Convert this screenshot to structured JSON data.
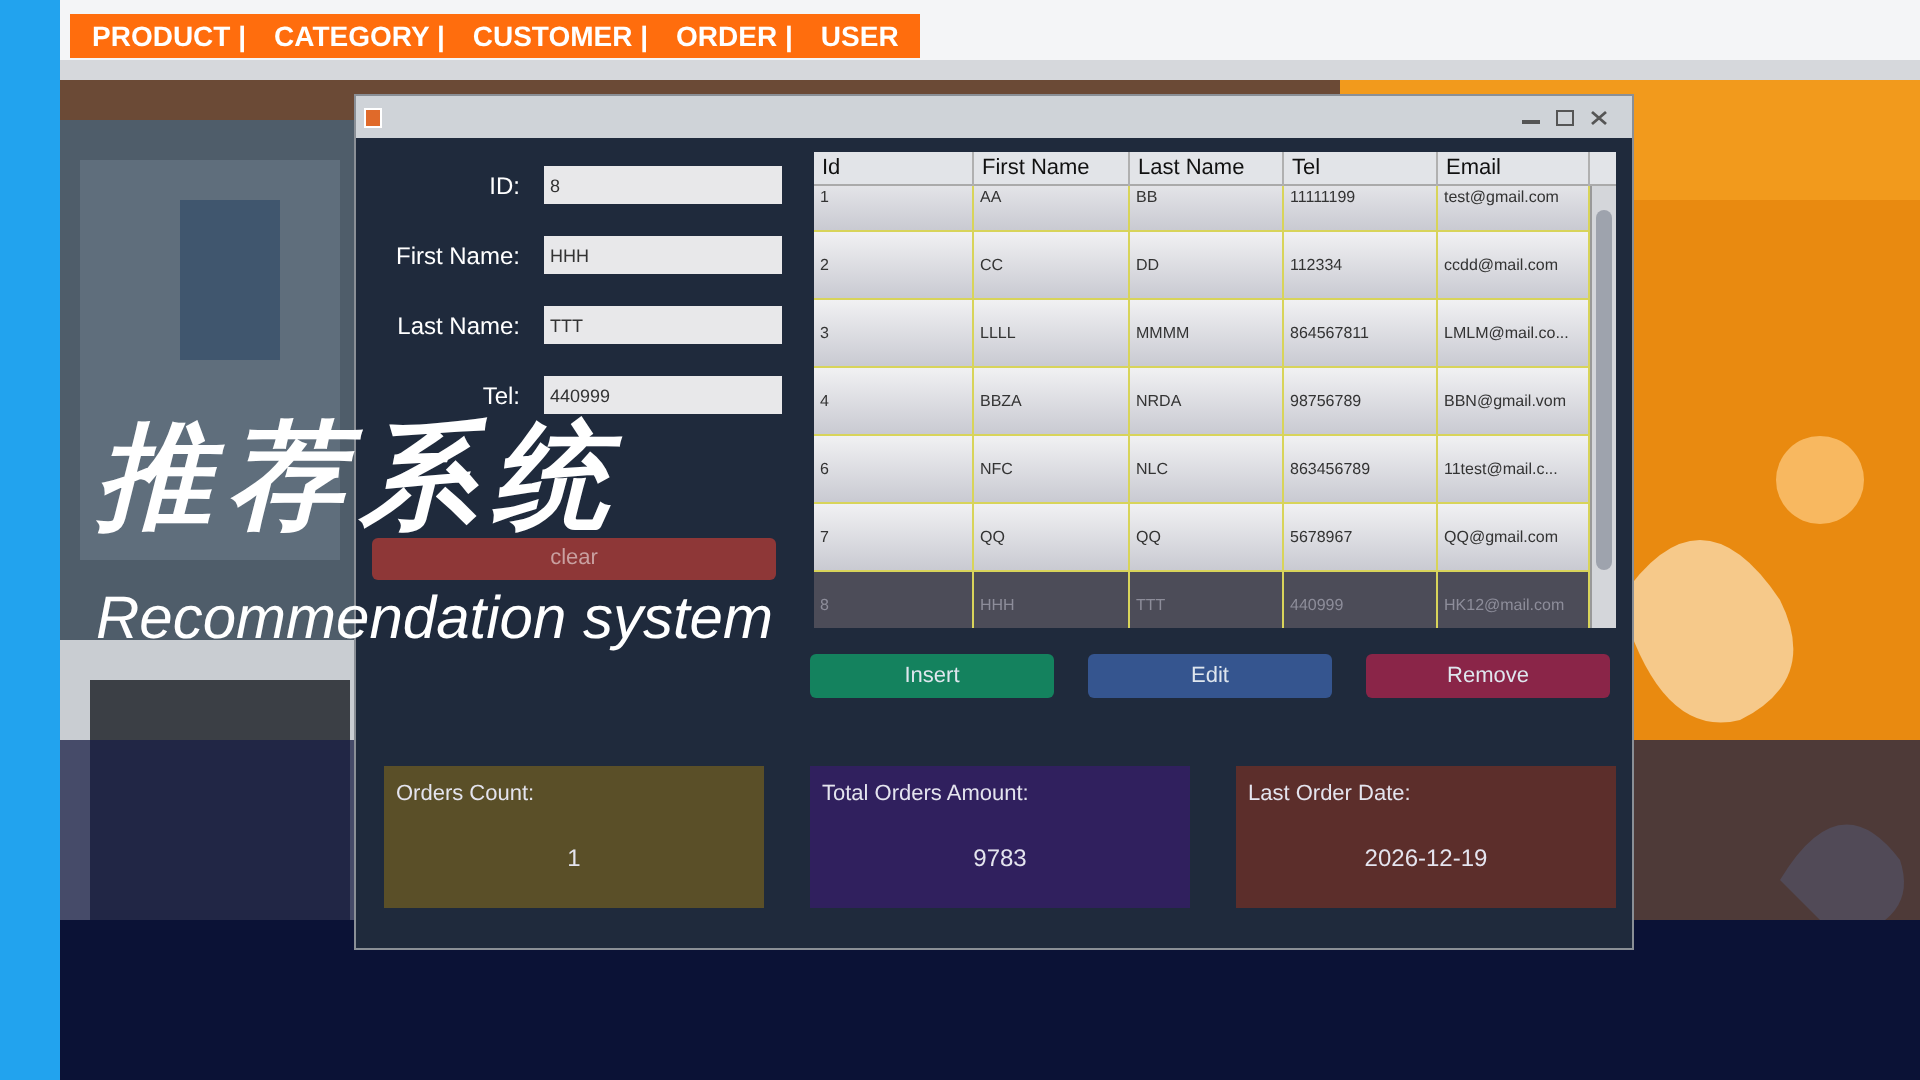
{
  "menu": [
    {
      "label": "PRODUCT |"
    },
    {
      "label": "CATEGORY |"
    },
    {
      "label": "CUSTOMER |"
    },
    {
      "label": "ORDER |"
    },
    {
      "label": "USER"
    }
  ],
  "form": {
    "fields": [
      {
        "label": "ID:",
        "value": "8"
      },
      {
        "label": "First Name:",
        "value": "HHH"
      },
      {
        "label": "Last Name:",
        "value": "TTT"
      },
      {
        "label": "Tel:",
        "value": "440999"
      }
    ],
    "clear_button": "clear"
  },
  "table": {
    "columns": [
      "Id",
      "First Name",
      "Last Name",
      "Tel",
      "Email"
    ],
    "rows": [
      {
        "cells": [
          "1",
          "AA",
          "BB",
          "11111199",
          "test@gmail.com"
        ],
        "selected": false
      },
      {
        "cells": [
          "2",
          "CC",
          "DD",
          "112334",
          "ccdd@mail.com"
        ],
        "selected": false
      },
      {
        "cells": [
          "3",
          "LLLL",
          "MMMM",
          "864567811",
          "LMLM@mail.co..."
        ],
        "selected": false
      },
      {
        "cells": [
          "4",
          "BBZA",
          "NRDA",
          "98756789",
          "BBN@gmail.vom"
        ],
        "selected": false
      },
      {
        "cells": [
          "6",
          "NFC",
          "NLC",
          "863456789",
          "11test@mail.c..."
        ],
        "selected": false
      },
      {
        "cells": [
          "7",
          "QQ",
          "QQ",
          "5678967",
          "QQ@gmail.com"
        ],
        "selected": false
      },
      {
        "cells": [
          "8",
          "HHH",
          "TTT",
          "440999",
          "HK12@mail.com"
        ],
        "selected": true
      }
    ]
  },
  "actions": [
    {
      "label": "Insert",
      "color": "#14825e"
    },
    {
      "label": "Edit",
      "color": "#35558f"
    },
    {
      "label": "Remove",
      "color": "#8a2548"
    }
  ],
  "stats": [
    {
      "label": "Orders Count:",
      "value": "1",
      "color": "#5a4f28"
    },
    {
      "label": "Total Orders Amount:",
      "value": "9783",
      "color": "#30205e"
    },
    {
      "label": "Last Order Date:",
      "value": "2026-12-19",
      "color": "#5c2e2b"
    }
  ],
  "overlay": {
    "title": "推荐系统",
    "subtitle": "Recommendation system"
  }
}
